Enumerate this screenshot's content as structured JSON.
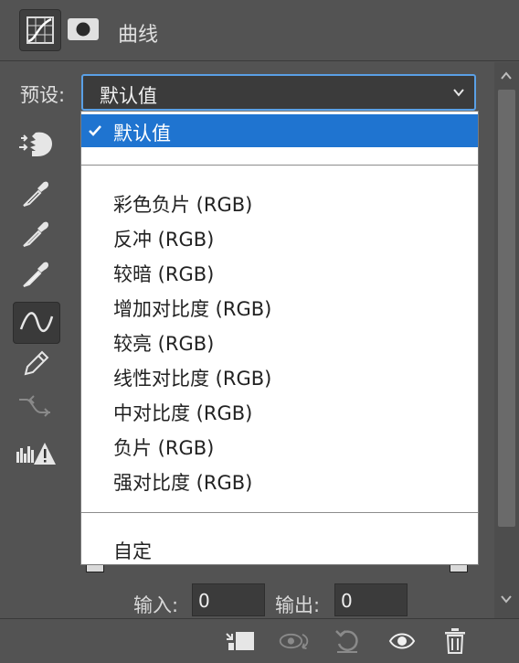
{
  "panel": {
    "title": "曲线"
  },
  "preset": {
    "label": "预设:",
    "value": "默认值"
  },
  "dropdown": {
    "selected": "默认值",
    "items": [
      "彩色负片 (RGB)",
      "反冲 (RGB)",
      "较暗 (RGB)",
      "增加对比度 (RGB)",
      "较亮 (RGB)",
      "线性对比度 (RGB)",
      "中对比度 (RGB)",
      "负片 (RGB)",
      "强对比度 (RGB)"
    ],
    "custom": "自定"
  },
  "io": {
    "input_label": "输入:",
    "input_value": "0",
    "output_label": "输出:",
    "output_value": "0"
  },
  "colors": {
    "accent": "#1f74d0",
    "panel_bg": "#535353",
    "focus_border": "#5aa0e6"
  }
}
